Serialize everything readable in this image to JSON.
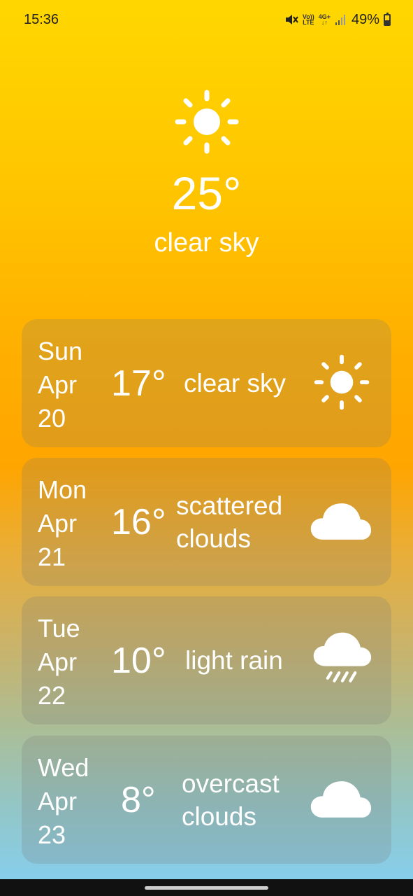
{
  "status_bar": {
    "time": "15:36",
    "lte_top": "Vo))",
    "lte_bottom": "LTE",
    "net_top": "4G+",
    "net_bottom": "↓↑",
    "battery": "49%"
  },
  "current": {
    "icon": "sun-icon",
    "temperature": "25°",
    "description": "clear sky"
  },
  "forecast": [
    {
      "day": "Sun",
      "month": "Apr",
      "date": "20",
      "temperature": "17°",
      "description": "clear sky",
      "icon": "sun-icon"
    },
    {
      "day": "Mon",
      "month": "Apr",
      "date": "21",
      "temperature": "16°",
      "description_line1": "scattered",
      "description_line2": "clouds",
      "icon": "cloud-icon"
    },
    {
      "day": "Tue",
      "month": "Apr",
      "date": "22",
      "temperature": "10°",
      "description": "light rain",
      "icon": "rain-cloud-icon"
    },
    {
      "day": "Wed",
      "month": "Apr",
      "date": "23",
      "temperature": "8°",
      "description_line1": "overcast",
      "description_line2": "clouds",
      "icon": "cloud-icon"
    }
  ],
  "colors": {
    "gradient_top": "#FFD700",
    "gradient_mid": "#FFA500",
    "gradient_bottom": "#87CEEB"
  }
}
